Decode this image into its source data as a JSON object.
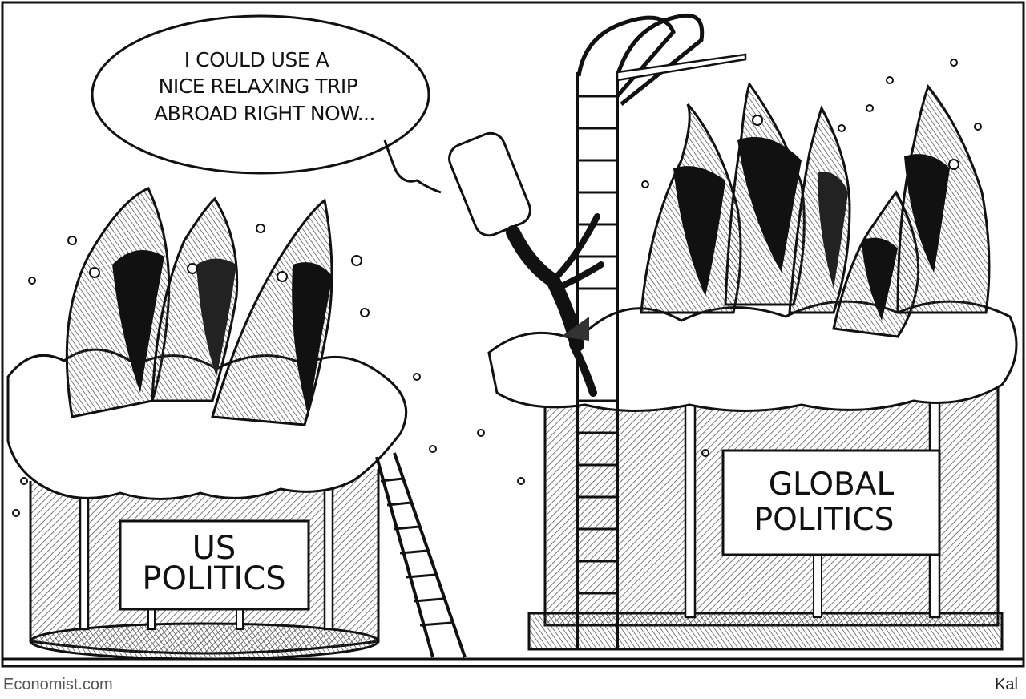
{
  "speech_bubble": {
    "lines": [
      "I COULD USE A",
      "NICE RELAXING TRIP",
      "ABROAD RIGHT NOW..."
    ]
  },
  "left_tank": {
    "sign_lines": [
      "US",
      "POLITICS"
    ]
  },
  "right_tank": {
    "sign_lines": [
      "GLOBAL",
      "POLITICS"
    ]
  },
  "credits": {
    "source": "Economist.com",
    "artist": "Kal"
  },
  "colors": {
    "ink": "#111111",
    "paper": "#ffffff",
    "hatch": "#777777"
  },
  "icons": [
    "shark-icon",
    "ladder-icon",
    "diving-board-icon",
    "diver-icon"
  ]
}
